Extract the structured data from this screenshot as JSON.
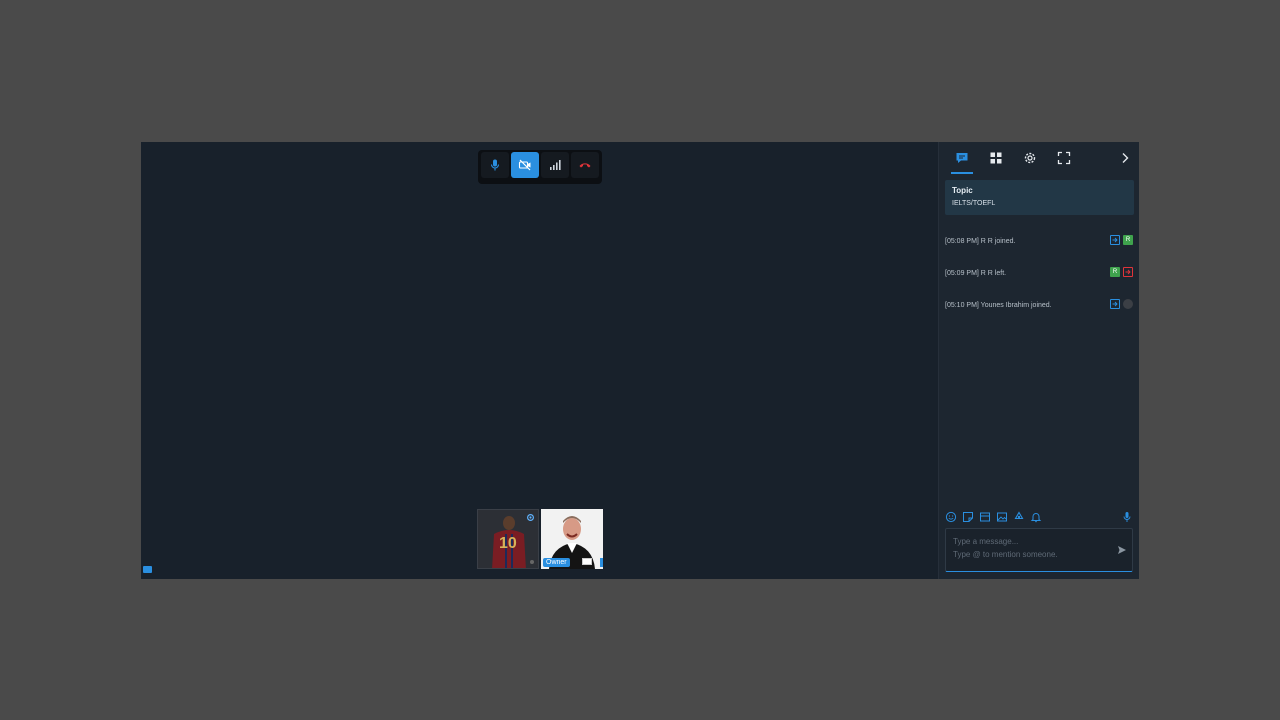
{
  "controls": [
    {
      "name": "microphone-button",
      "icon": "microphone-icon",
      "active": false
    },
    {
      "name": "camera-off-button",
      "icon": "camera-off-icon",
      "active": true
    },
    {
      "name": "connection-quality-button",
      "icon": "signal-bars-icon",
      "active": false
    },
    {
      "name": "hang-up-button",
      "icon": "phone-hangup-icon",
      "active": false
    }
  ],
  "participants": [
    {
      "name": "participant-thumb-1",
      "badge": ""
    },
    {
      "name": "participant-thumb-2",
      "badge": "Owner"
    }
  ],
  "sidebar": {
    "tabs": [
      {
        "name": "tab-chat",
        "icon": "chat-icon",
        "active": true
      },
      {
        "name": "tab-grid",
        "icon": "grid-icon"
      },
      {
        "name": "tab-settings",
        "icon": "gear-icon"
      },
      {
        "name": "tab-fullscreen",
        "icon": "fullscreen-icon"
      }
    ],
    "topic": {
      "label": "Topic",
      "value": "IELTS/TOEFL"
    },
    "messages": [
      {
        "text": "[05:08 PM] R R joined.",
        "icons": [
          "join-icon",
          "avatar-R"
        ],
        "avatar_letter": "R"
      },
      {
        "text": "[05:09 PM] R R left.",
        "icons": [
          "avatar-R",
          "leave-icon"
        ],
        "avatar_letter": "R"
      },
      {
        "text": "[05:10 PM] Younes Ibrahim joined.",
        "icons": [
          "join-icon",
          "avatar-photo"
        ],
        "avatar_letter": ""
      }
    ],
    "composer": {
      "placeholder": "Type a message...\nType @ to mention someone.",
      "tools": [
        "emoji-icon",
        "sticker-icon",
        "gif-icon",
        "image-icon",
        "recycle-icon",
        "bell-icon"
      ]
    }
  },
  "colors": {
    "accent": "#2a8fe0",
    "background": "#192029",
    "page": "#4a4a4a",
    "success": "#3fa34d",
    "danger": "#e0343a"
  }
}
